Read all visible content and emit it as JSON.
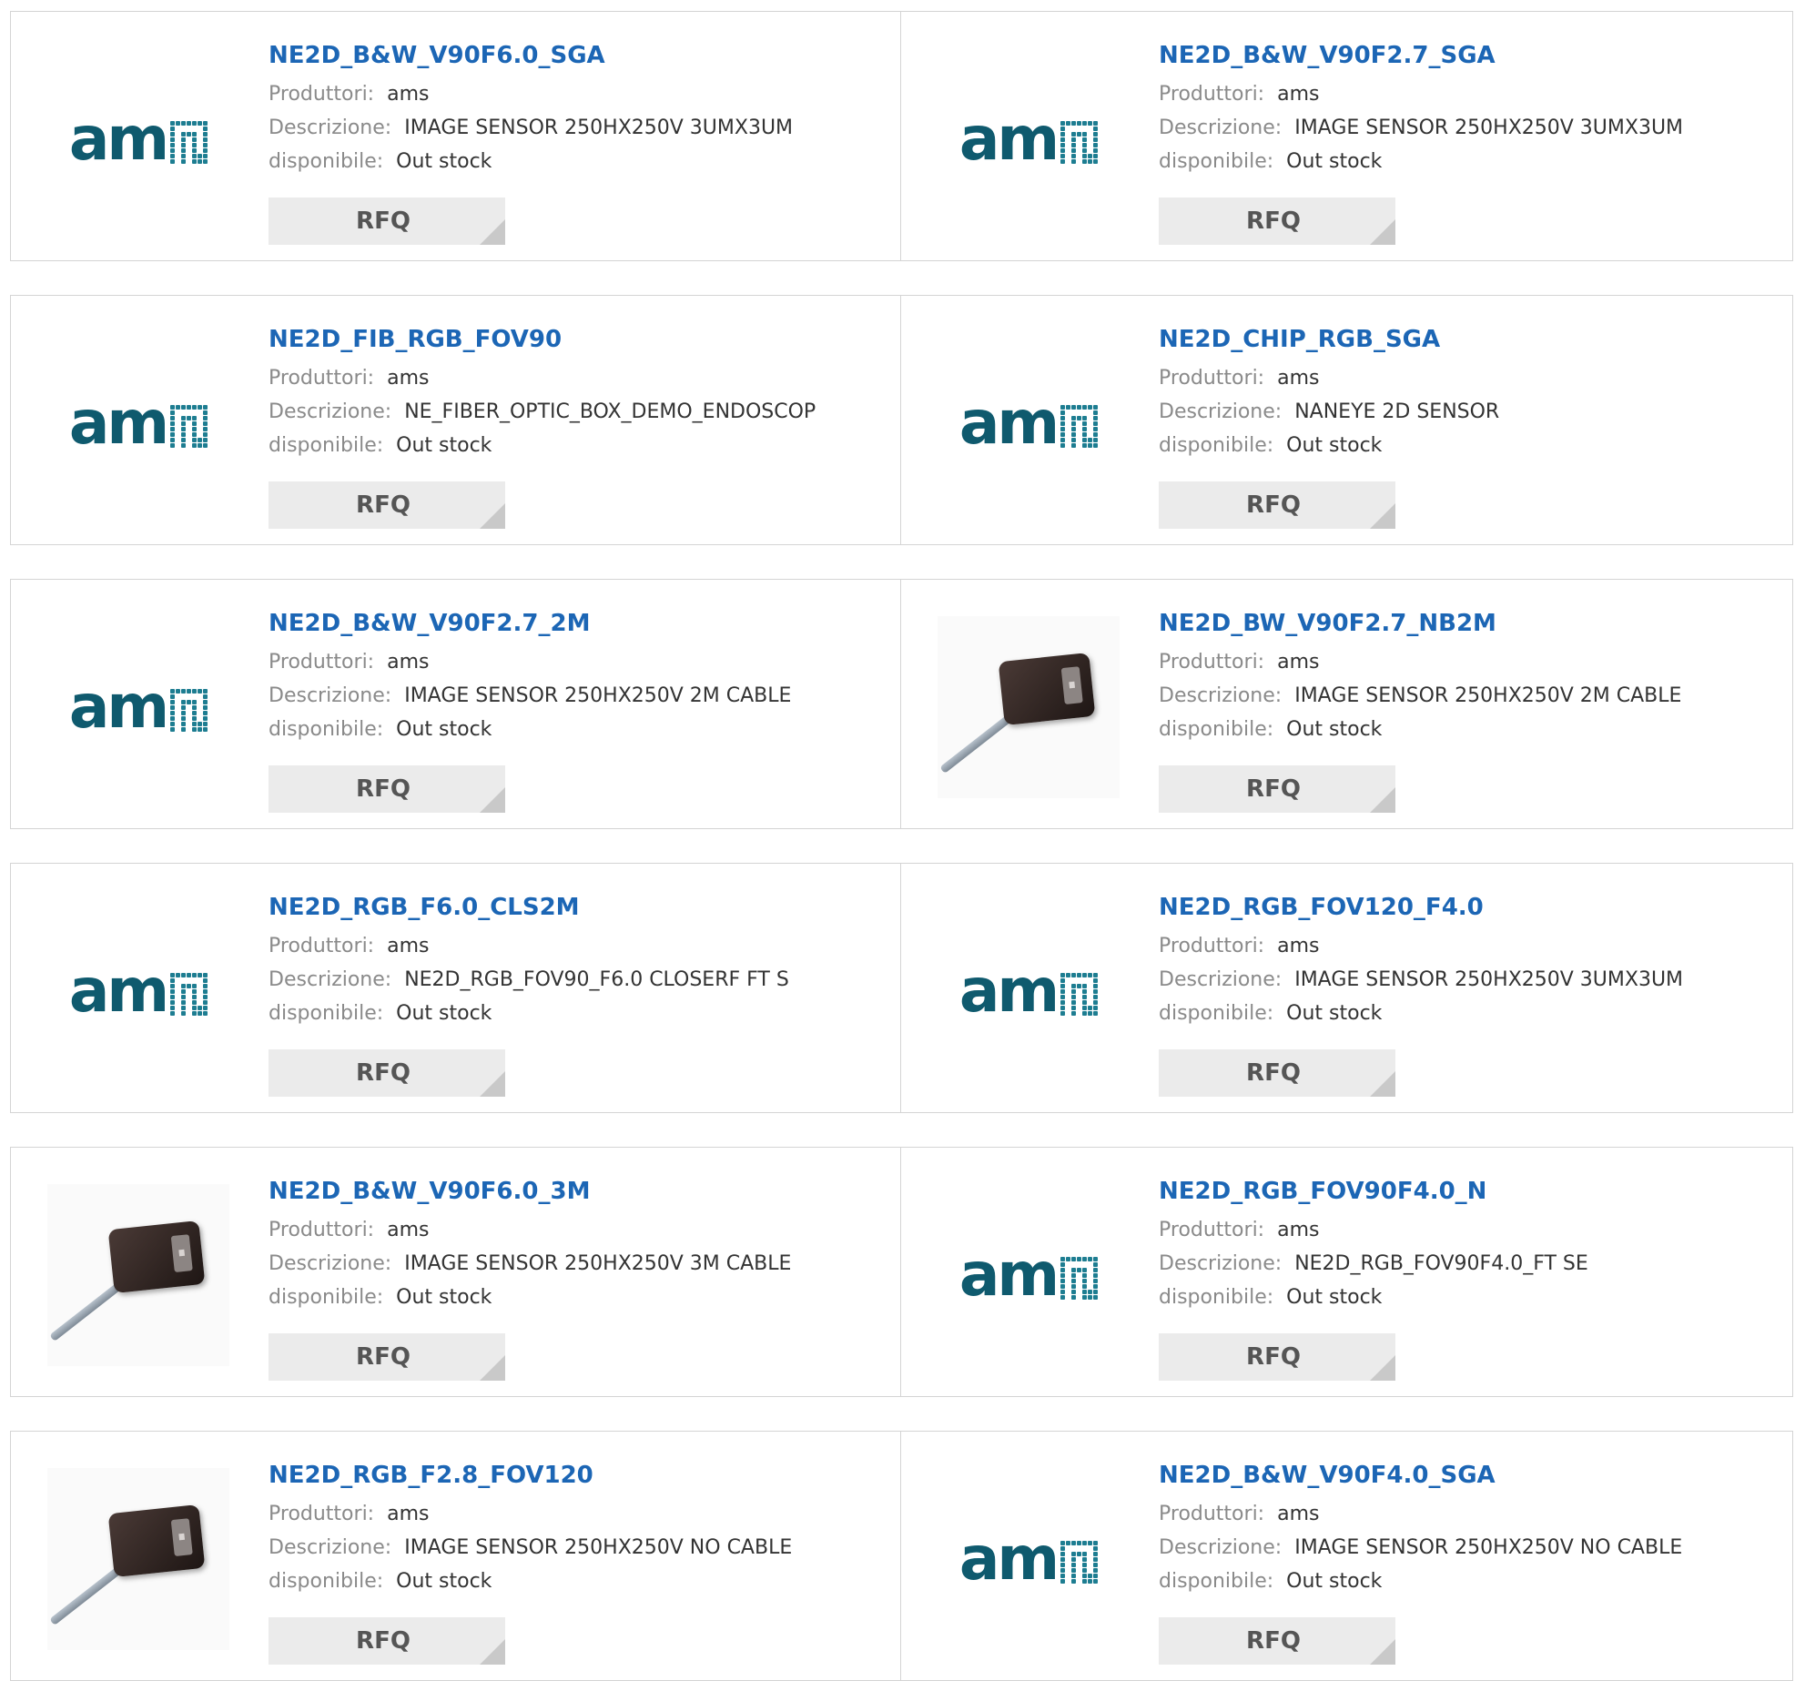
{
  "labels": {
    "manufacturer": "Produttori:",
    "description": "Descrizione:",
    "availability": "disponibile:",
    "rfq": "RFQ"
  },
  "brand_colors": {
    "title_link": "#1c66b5",
    "logo_teal": "#0f5a6e"
  },
  "products": [
    {
      "part": "NE2D_B&W_V90F6.0_SGA",
      "manufacturer": "ams",
      "description": "IMAGE SENSOR 250HX250V 3UMX3UM",
      "availability": "Out stock",
      "image": "ams-logo"
    },
    {
      "part": "NE2D_B&W_V90F2.7_SGA",
      "manufacturer": "ams",
      "description": "IMAGE SENSOR 250HX250V 3UMX3UM",
      "availability": "Out stock",
      "image": "ams-logo"
    },
    {
      "part": "NE2D_FIB_RGB_FOV90",
      "manufacturer": "ams",
      "description": "NE_FIBER_OPTIC_BOX_DEMO_ENDOSCOP",
      "availability": "Out stock",
      "image": "ams-logo"
    },
    {
      "part": "NE2D_CHIP_RGB_SGA",
      "manufacturer": "ams",
      "description": "NANEYE 2D SENSOR",
      "availability": "Out stock",
      "image": "ams-logo"
    },
    {
      "part": "NE2D_B&W_V90F2.7_2M",
      "manufacturer": "ams",
      "description": "IMAGE SENSOR 250HX250V 2M CABLE",
      "availability": "Out stock",
      "image": "ams-logo"
    },
    {
      "part": "NE2D_BW_V90F2.7_NB2M",
      "manufacturer": "ams",
      "description": "IMAGE SENSOR 250HX250V 2M CABLE",
      "availability": "Out stock",
      "image": "sensor-photo"
    },
    {
      "part": "NE2D_RGB_F6.0_CLS2M",
      "manufacturer": "ams",
      "description": "NE2D_RGB_FOV90_F6.0 CLOSERF FT S",
      "availability": "Out stock",
      "image": "ams-logo"
    },
    {
      "part": "NE2D_RGB_FOV120_F4.0",
      "manufacturer": "ams",
      "description": "IMAGE SENSOR 250HX250V 3UMX3UM",
      "availability": "Out stock",
      "image": "ams-logo"
    },
    {
      "part": "NE2D_B&W_V90F6.0_3M",
      "manufacturer": "ams",
      "description": "IMAGE SENSOR 250HX250V 3M CABLE",
      "availability": "Out stock",
      "image": "sensor-photo"
    },
    {
      "part": "NE2D_RGB_FOV90F4.0_N",
      "manufacturer": "ams",
      "description": "NE2D_RGB_FOV90F4.0_FT SE",
      "availability": "Out stock",
      "image": "ams-logo"
    },
    {
      "part": "NE2D_RGB_F2.8_FOV120",
      "manufacturer": "ams",
      "description": "IMAGE SENSOR 250HX250V NO CABLE",
      "availability": "Out stock",
      "image": "sensor-photo"
    },
    {
      "part": "NE2D_B&W_V90F4.0_SGA",
      "manufacturer": "ams",
      "description": "IMAGE SENSOR 250HX250V NO CABLE",
      "availability": "Out stock",
      "image": "ams-logo"
    }
  ]
}
